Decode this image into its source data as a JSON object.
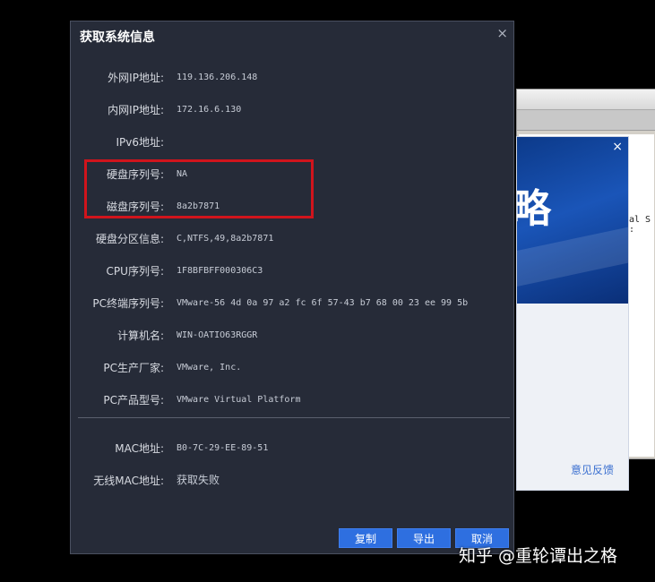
{
  "dialog": {
    "title": "获取系统信息",
    "close_glyph": "×",
    "fields": [
      {
        "label": "外网IP地址:",
        "value": "119.136.206.148"
      },
      {
        "label": "内网IP地址:",
        "value": "172.16.6.130"
      },
      {
        "label": "IPv6地址:",
        "value": ""
      },
      {
        "label": "硬盘序列号:",
        "value": "NA"
      },
      {
        "label": "磁盘序列号:",
        "value": "8a2b7871"
      },
      {
        "label": "硬盘分区信息:",
        "value": "C,NTFS,49,8a2b7871"
      },
      {
        "label": "CPU序列号:",
        "value": "1F8BFBFF000306C3"
      },
      {
        "label": "PC终端序列号:",
        "value": "VMware-56 4d 0a 97 a2 fc 6f 57-43 b7 68 00 23 ee 99 5b"
      },
      {
        "label": "计算机名:",
        "value": "WIN-OATIO63RGGR"
      },
      {
        "label": "PC生产厂家:",
        "value": "VMware, Inc."
      },
      {
        "label": "PC产品型号:",
        "value": "VMware Virtual Platform"
      },
      {
        "label": "MAC地址:",
        "value": "B0-7C-29-EE-89-51"
      },
      {
        "label": "无线MAC地址:",
        "value": "获取失败"
      }
    ],
    "buttons": {
      "copy": "复制",
      "export": "导出",
      "cancel": "取消"
    }
  },
  "background_popup": {
    "close_glyph": "×",
    "banner_glyph": "略",
    "feedback_link": "意见反馈"
  },
  "background_window": {
    "snippet": "al S :"
  },
  "watermark": "知乎 @重轮谭出之格",
  "colors": {
    "dialog_bg": "#262b38",
    "highlight_border": "#d0141c",
    "button_bg": "#2e6fe0",
    "banner_blue": "#1a55b8"
  }
}
